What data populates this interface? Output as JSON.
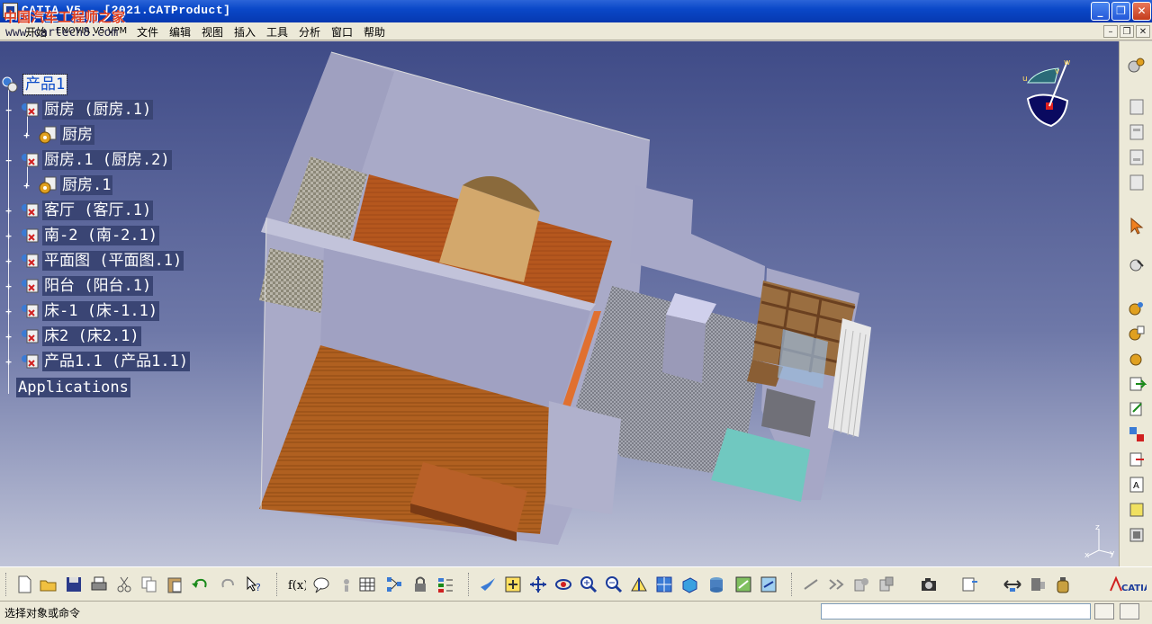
{
  "window": {
    "title": "CATIA V5 - [2021.CATProduct]",
    "min_label": "_",
    "max_label": "❐",
    "close_label": "✕"
  },
  "watermark": {
    "text": "中国汽车工程师之家",
    "url": "www.cartech8.com"
  },
  "menubar": {
    "items": [
      "开始",
      "ENOVIA V5 VPM",
      "文件",
      "编辑",
      "视图",
      "插入",
      "工具",
      "分析",
      "窗口",
      "帮助"
    ],
    "mdi_min": "–",
    "mdi_restore": "❐",
    "mdi_close": "✕"
  },
  "tree": {
    "root": "产品1",
    "nodes": [
      {
        "label": "厨房 (厨房.1)",
        "child": "厨房"
      },
      {
        "label": "厨房.1 (厨房.2)",
        "child": "厨房.1"
      },
      {
        "label": "客厅 (客厅.1)"
      },
      {
        "label": "南-2 (南-2.1)"
      },
      {
        "label": "平面图 (平面图.1)"
      },
      {
        "label": "阳台 (阳台.1)"
      },
      {
        "label": "床-1 (床-1.1)"
      },
      {
        "label": "床2 (床2.1)"
      },
      {
        "label": "产品1.1 (产品1.1)"
      }
    ],
    "applications": "Applications"
  },
  "compass": {
    "u": "u",
    "v": "v",
    "w": "w"
  },
  "axis": {
    "x": "x",
    "y": "y",
    "z": "z"
  },
  "status": {
    "prompt": "选择对象或命令",
    "command_value": ""
  },
  "colors": {
    "accent": "#0a48c8",
    "viewport_top": "#3f4b87",
    "viewport_bottom": "#c0c4d8"
  },
  "icons": {
    "bottom": [
      "new-icon",
      "open-icon",
      "save-icon",
      "print-icon",
      "cut-icon",
      "copy-icon",
      "paste-icon",
      "undo-icon",
      "redo-icon",
      "whats-this-icon",
      "formula-icon",
      "comment-icon",
      "knowledge-icon",
      "table-icon",
      "graph-icon",
      "lock-icon",
      "sort-icon",
      "fly-icon",
      "fit-all-icon",
      "pan-icon",
      "rotate-icon",
      "zoom-in-icon",
      "zoom-out-icon",
      "normal-view-icon",
      "multi-view-icon",
      "iso-view-icon",
      "render-style-icon",
      "hide-show-icon",
      "swap-icon",
      "measure-between-icon",
      "measure-item-icon",
      "inertia-icon",
      "camera-icon",
      "catalog-icon",
      "clash-icon",
      "sectioning-icon",
      "bottle-icon",
      "catia-logo-icon"
    ],
    "right": [
      "settings-gear-icon",
      "sheet-icon",
      "sheet-icon-2",
      "sheet-icon-3",
      "sheet-icon-4",
      "select-arrow-icon",
      "snap-icon",
      "component-icon",
      "product-icon",
      "part-icon",
      "insert-existing-icon",
      "replace-icon",
      "reorder-icon",
      "renumber-icon",
      "bom-icon",
      "constraint-icon",
      "scenes-icon"
    ]
  }
}
